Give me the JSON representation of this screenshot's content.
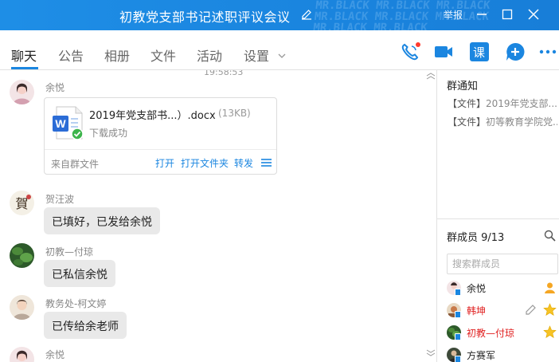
{
  "window": {
    "title": "初教党支部书记述职评议会议",
    "report_label": "举报",
    "watermark_lines": [
      "MR.BLACK MR.BLACK MR.BLACK",
      "MR.BLACK MR.BLACK MR.BLACK",
      "MR.BLACK MR.BLACK"
    ]
  },
  "tabs": [
    {
      "label": "聊天",
      "active": true
    },
    {
      "label": "公告"
    },
    {
      "label": "相册"
    },
    {
      "label": "文件"
    },
    {
      "label": "活动"
    },
    {
      "label": "设置"
    }
  ],
  "toolbar": {
    "course_label": "课",
    "colors": {
      "accent": "#1b86e0",
      "titlebar": "#1a84de",
      "notify_dot": "#ff3b30"
    }
  },
  "chat": {
    "timestamp": "19:58:53",
    "messages": [
      {
        "sender": "余悦",
        "type": "file",
        "file": {
          "name": "2019年党支部书...）.docx",
          "size": "(13KB)",
          "status": "下载成功",
          "source": "来自群文件",
          "actions": [
            "打开",
            "打开文件夹",
            "转发"
          ]
        }
      },
      {
        "sender": "贺汪波",
        "type": "text",
        "text": "已填好，已发给余悦"
      },
      {
        "sender": "初教—付琼",
        "type": "text",
        "text": "已私信余悦"
      },
      {
        "sender": "教务处-柯文婷",
        "type": "text",
        "text": "已传给余老师"
      },
      {
        "sender": "余悦",
        "type": "text",
        "text": ""
      }
    ]
  },
  "side": {
    "notice_title": "群通知",
    "notices": [
      {
        "tag": "【文件】",
        "text": "2019年党支部..."
      },
      {
        "tag": "【文件】",
        "text": "初等教育学院党..."
      }
    ],
    "members_label": "群成员 9/13",
    "search_placeholder": "搜索群成员",
    "members": [
      {
        "name": "余悦",
        "red": false,
        "icon": "owner-icon"
      },
      {
        "name": "韩坤",
        "red": true,
        "icon": "admin-star-icon"
      },
      {
        "name": "初教—付琼",
        "red": true,
        "icon": "admin-star-icon"
      },
      {
        "name": "方赛军",
        "red": false,
        "icon": ""
      }
    ]
  }
}
